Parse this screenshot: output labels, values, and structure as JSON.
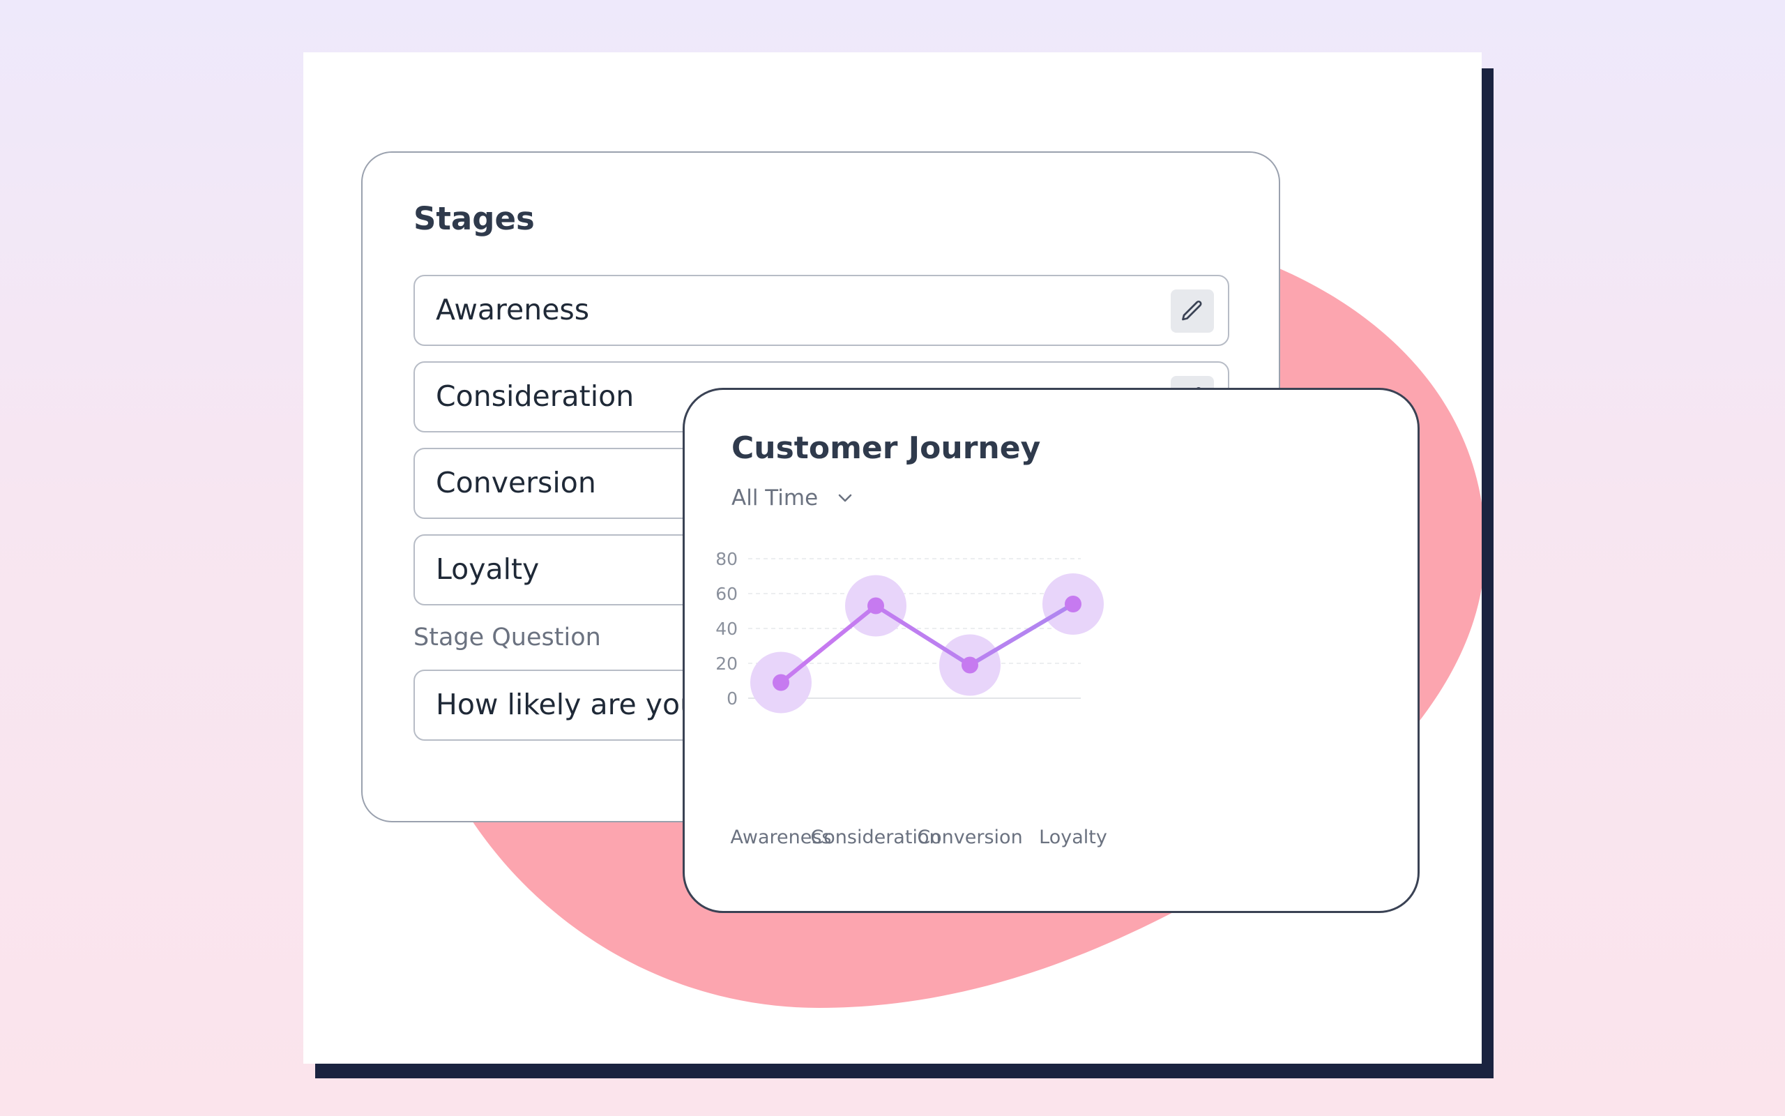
{
  "stages_panel": {
    "title": "Stages",
    "stages": [
      {
        "label": "Awareness"
      },
      {
        "label": "Consideration"
      },
      {
        "label": "Conversion"
      },
      {
        "label": "Loyalty"
      }
    ],
    "question_label": "Stage Question",
    "question_value": "How likely are you t"
  },
  "journey_panel": {
    "title": "Customer Journey",
    "range": "All Time",
    "icons": {
      "edit": "pencil-icon",
      "dropdown": "chevron-down-icon"
    }
  },
  "colors": {
    "blob": "#FCA5AF",
    "frame_shadow": "#1A2340",
    "line_start": "#C67AF0",
    "line_end": "#8CC4F0",
    "point": "#C67AF0",
    "halo": "#E8D5FA"
  },
  "chart_data": {
    "type": "line",
    "categories": [
      "Awareness",
      "Consideration",
      "Conversion",
      "Loyalty"
    ],
    "series": [
      {
        "values": [
          9,
          53,
          19,
          54
        ]
      }
    ],
    "title": "Customer Journey",
    "xlabel": "",
    "ylabel": "",
    "ylim": [
      0,
      80
    ],
    "yticks": [
      0,
      20,
      40,
      60,
      80
    ],
    "grid": true
  }
}
